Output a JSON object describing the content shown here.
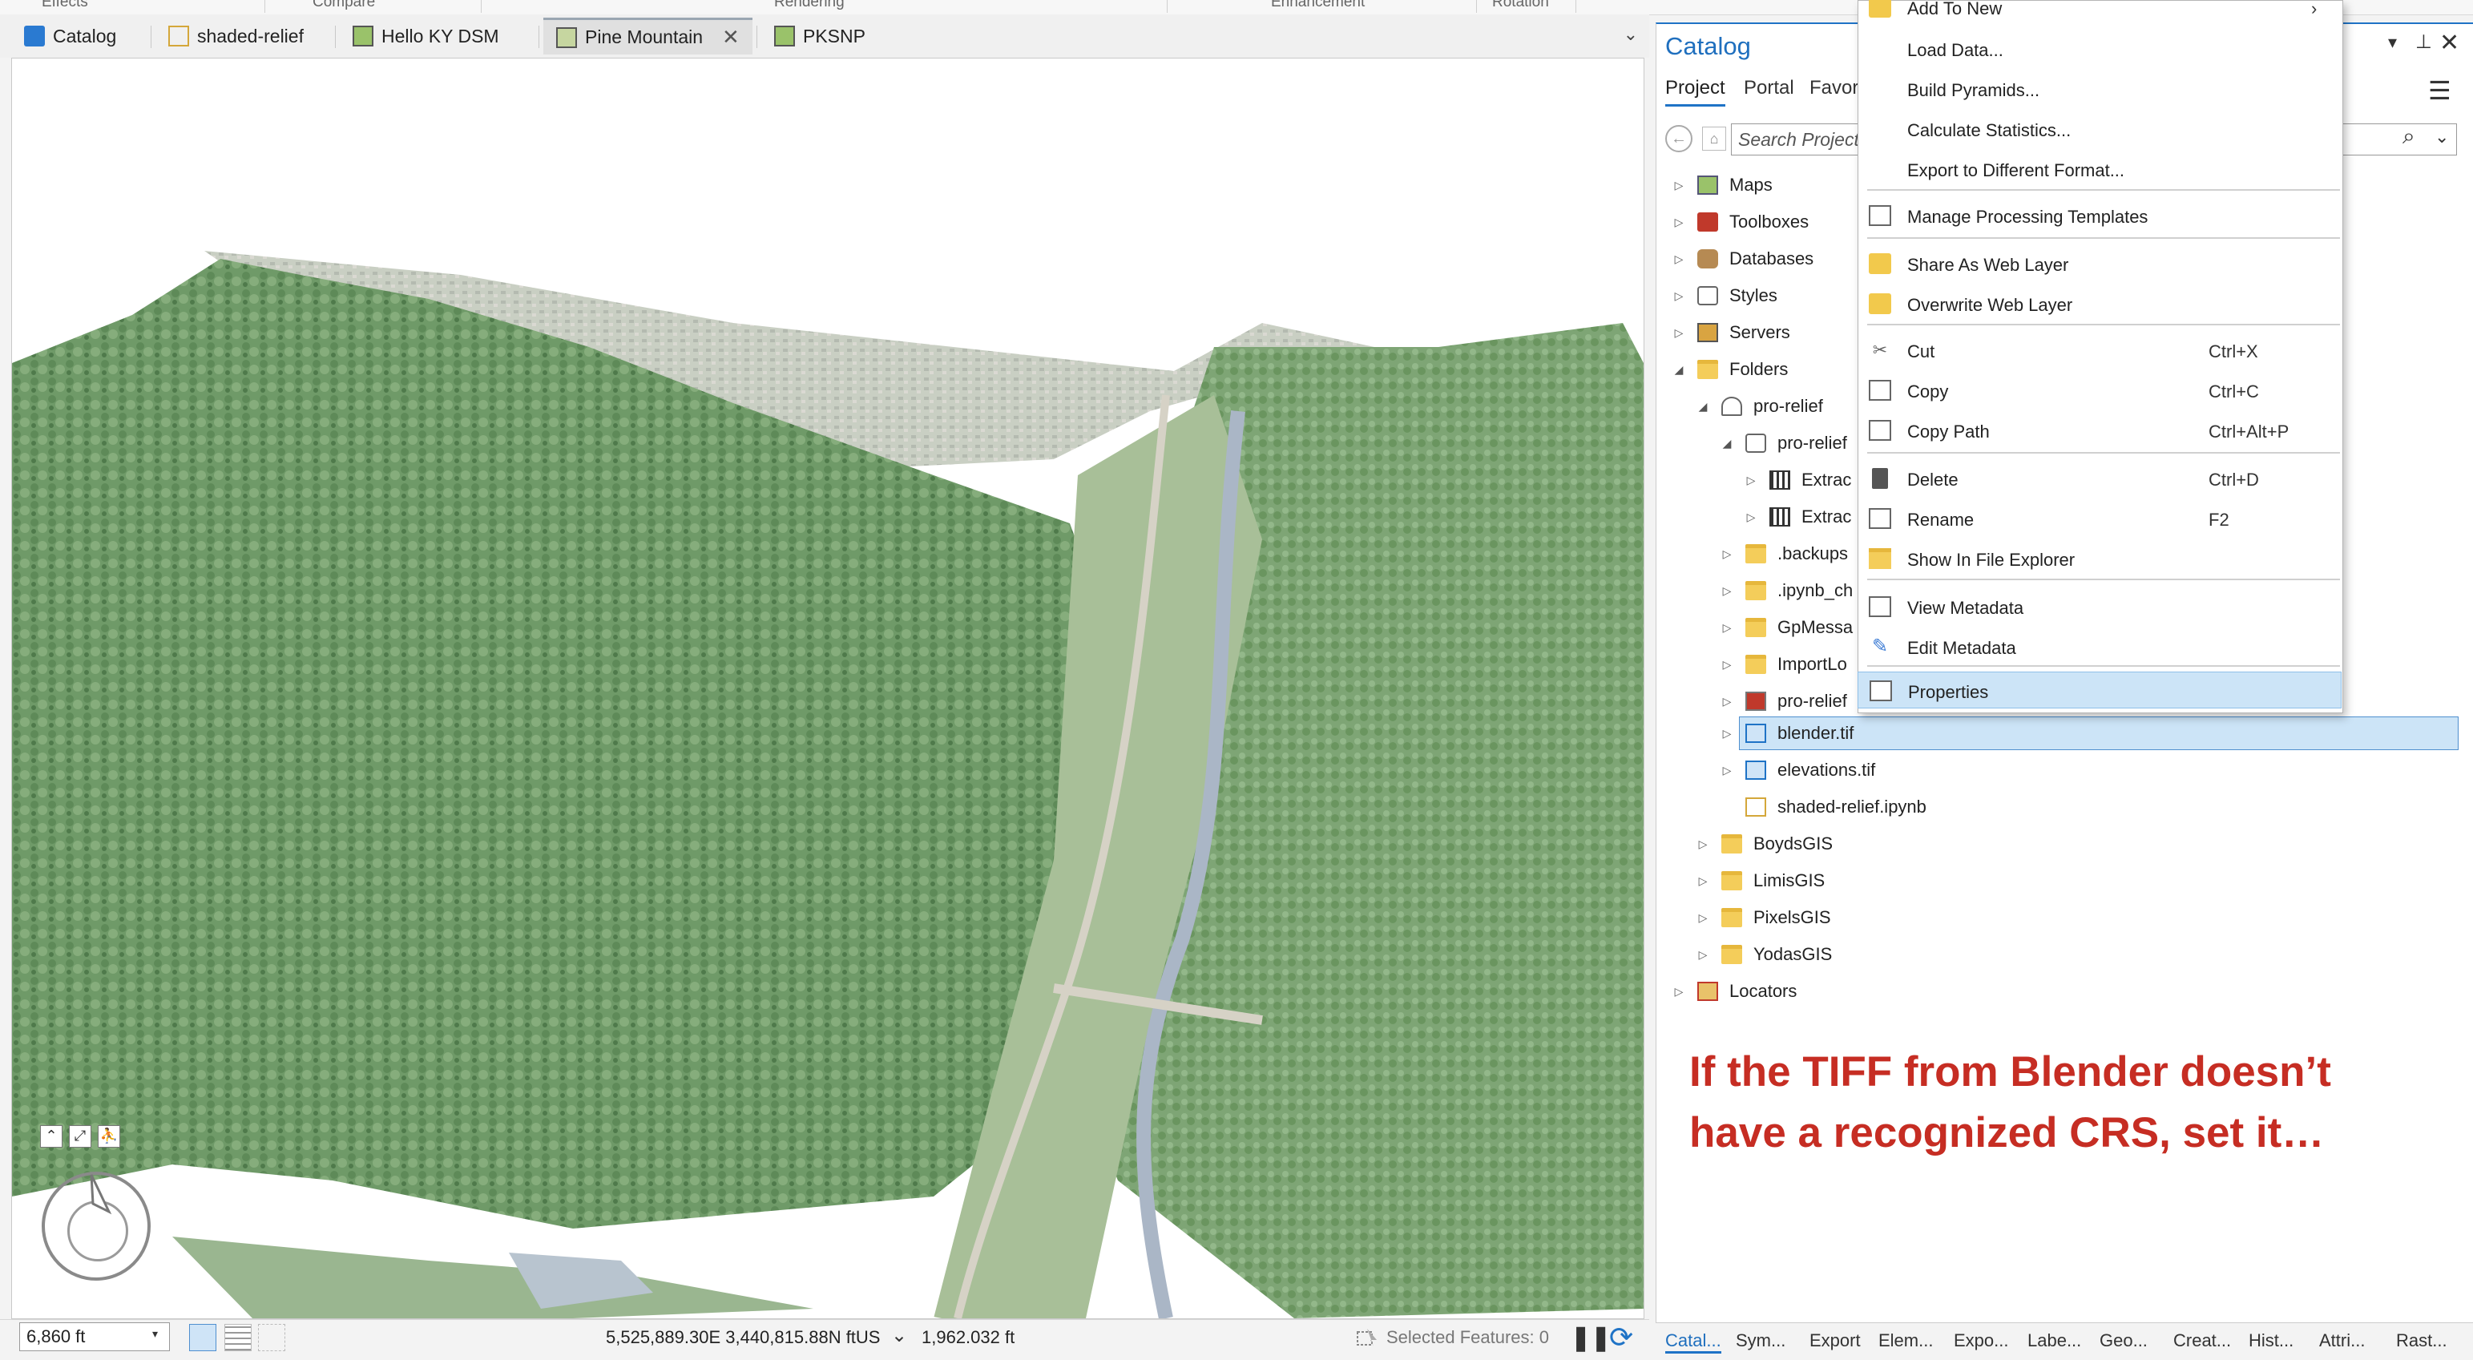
{
  "ribbon": {
    "groups": [
      "Effects",
      "Compare",
      "Rendering",
      "Enhancement",
      "Rotation"
    ]
  },
  "map_tabs": [
    {
      "label": "Catalog",
      "icon": "catalog-icon"
    },
    {
      "label": "shaded-relief",
      "icon": "notebook-icon"
    },
    {
      "label": "Hello KY DSM",
      "icon": "map-icon"
    },
    {
      "label": "Pine Mountain",
      "icon": "scene-icon",
      "active": true
    },
    {
      "label": "PKSNP",
      "icon": "map-icon"
    }
  ],
  "status": {
    "scale": "6,860 ft",
    "coordinates": "5,525,889.30E 3,440,815.88N ftUS",
    "elevation": "1,962.032 ft",
    "selected_features": "Selected Features: 0"
  },
  "catalog": {
    "title": "Catalog",
    "tabs": [
      "Project",
      "Portal",
      "Favor"
    ],
    "search_placeholder": "Search Project",
    "tree": [
      {
        "label": "Maps",
        "icon": "map-icon"
      },
      {
        "label": "Toolboxes",
        "icon": "toolbox-icon"
      },
      {
        "label": "Databases",
        "icon": "database-icon"
      },
      {
        "label": "Styles",
        "icon": "style-icon"
      },
      {
        "label": "Servers",
        "icon": "server-icon"
      },
      {
        "label": "Folders",
        "icon": "folder-icon"
      },
      {
        "label": "pro-relief",
        "icon": "home-folder-icon"
      },
      {
        "label": "pro-relief",
        "icon": "geodatabase-icon"
      },
      {
        "label": "Extrac",
        "icon": "raster-icon"
      },
      {
        "label": "Extrac",
        "icon": "raster-icon"
      },
      {
        "label": ".backups",
        "icon": "folder-icon"
      },
      {
        "label": ".ipynb_ch",
        "icon": "folder-icon"
      },
      {
        "label": "GpMessa",
        "icon": "folder-icon"
      },
      {
        "label": "ImportLo",
        "icon": "folder-icon"
      },
      {
        "label": "pro-relief",
        "icon": "toolbox-icon"
      },
      {
        "label": "blender.tif",
        "icon": "tif-icon"
      },
      {
        "label": "elevations.tif",
        "icon": "tif-icon"
      },
      {
        "label": "shaded-relief.ipynb",
        "icon": "notebook-icon"
      },
      {
        "label": "BoydsGIS",
        "icon": "folder-icon"
      },
      {
        "label": "LimisGIS",
        "icon": "folder-icon"
      },
      {
        "label": "PixelsGIS",
        "icon": "folder-icon"
      },
      {
        "label": "YodasGIS",
        "icon": "folder-icon"
      },
      {
        "label": "Locators",
        "icon": "locator-icon"
      }
    ],
    "bottom_tabs": [
      "Catal...",
      "Sym...",
      "Export",
      "Elem...",
      "Expo...",
      "Labe...",
      "Geo...",
      "Creat...",
      "Hist...",
      "Attri...",
      "Rast..."
    ]
  },
  "context_menu": {
    "items": [
      {
        "label": "Add To New",
        "shortcut": "",
        "icon": "web-layer-icon"
      },
      {
        "label": "Load Data...",
        "shortcut": ""
      },
      {
        "label": "Build Pyramids...",
        "shortcut": ""
      },
      {
        "label": "Calculate Statistics...",
        "shortcut": ""
      },
      {
        "label": "Export to Different Format...",
        "shortcut": ""
      },
      {
        "label": "Manage Processing Templates",
        "shortcut": "",
        "icon": "template-icon"
      },
      {
        "label": "Share As Web Layer",
        "shortcut": "",
        "icon": "web-layer-icon"
      },
      {
        "label": "Overwrite Web Layer",
        "shortcut": "",
        "icon": "web-layer-icon"
      },
      {
        "label": "Cut",
        "shortcut": "Ctrl+X",
        "icon": "scissors-icon"
      },
      {
        "label": "Copy",
        "shortcut": "Ctrl+C",
        "icon": "copy-icon"
      },
      {
        "label": "Copy Path",
        "shortcut": "Ctrl+Alt+P",
        "icon": "copy-path-icon"
      },
      {
        "label": "Delete",
        "shortcut": "Ctrl+D",
        "icon": "trash-icon"
      },
      {
        "label": "Rename",
        "shortcut": "F2",
        "icon": "rename-icon"
      },
      {
        "label": "Show In File Explorer",
        "shortcut": "",
        "icon": "folder-icon"
      },
      {
        "label": "View Metadata",
        "shortcut": "",
        "icon": "document-icon"
      },
      {
        "label": "Edit Metadata",
        "shortcut": "",
        "icon": "pencil-icon"
      },
      {
        "label": "Properties",
        "shortcut": "",
        "icon": "properties-icon",
        "highlighted": true
      }
    ]
  },
  "annotation": {
    "line1": "If the TIFF from Blender doesn’t",
    "line2": "have a recognized CRS, set it…"
  },
  "colors": {
    "accent": "#1f73c6",
    "selection": "#cce4f7",
    "annotation": "#c62d23"
  }
}
